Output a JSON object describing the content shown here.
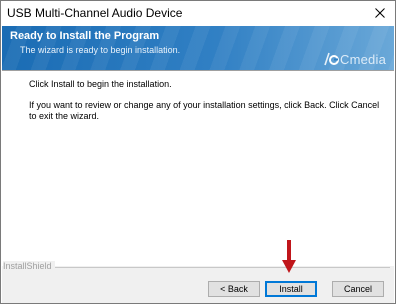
{
  "window": {
    "title": "USB Multi-Channel Audio Device",
    "close_glyph": "close-icon"
  },
  "banner": {
    "heading": "Ready to Install the Program",
    "subheading": "The wizard is ready to begin installation.",
    "brand_name": "Cmedia",
    "brand_icon": "cmedia-logo-icon"
  },
  "content": {
    "line1": "Click Install to begin the installation.",
    "line2": "If you want to review or change any of your installation settings, click Back. Click Cancel to exit the wizard."
  },
  "footer": {
    "installshield_label": "InstallShield",
    "back_label": "< Back",
    "install_label": "Install",
    "cancel_label": "Cancel"
  },
  "annotation": {
    "arrow_icon": "red-down-arrow-icon",
    "arrow_color": "#c0161b"
  },
  "colors": {
    "banner_blue": "#1a6cb4",
    "focus_blue": "#0078d7",
    "footer_bg": "#f0f0f0"
  }
}
